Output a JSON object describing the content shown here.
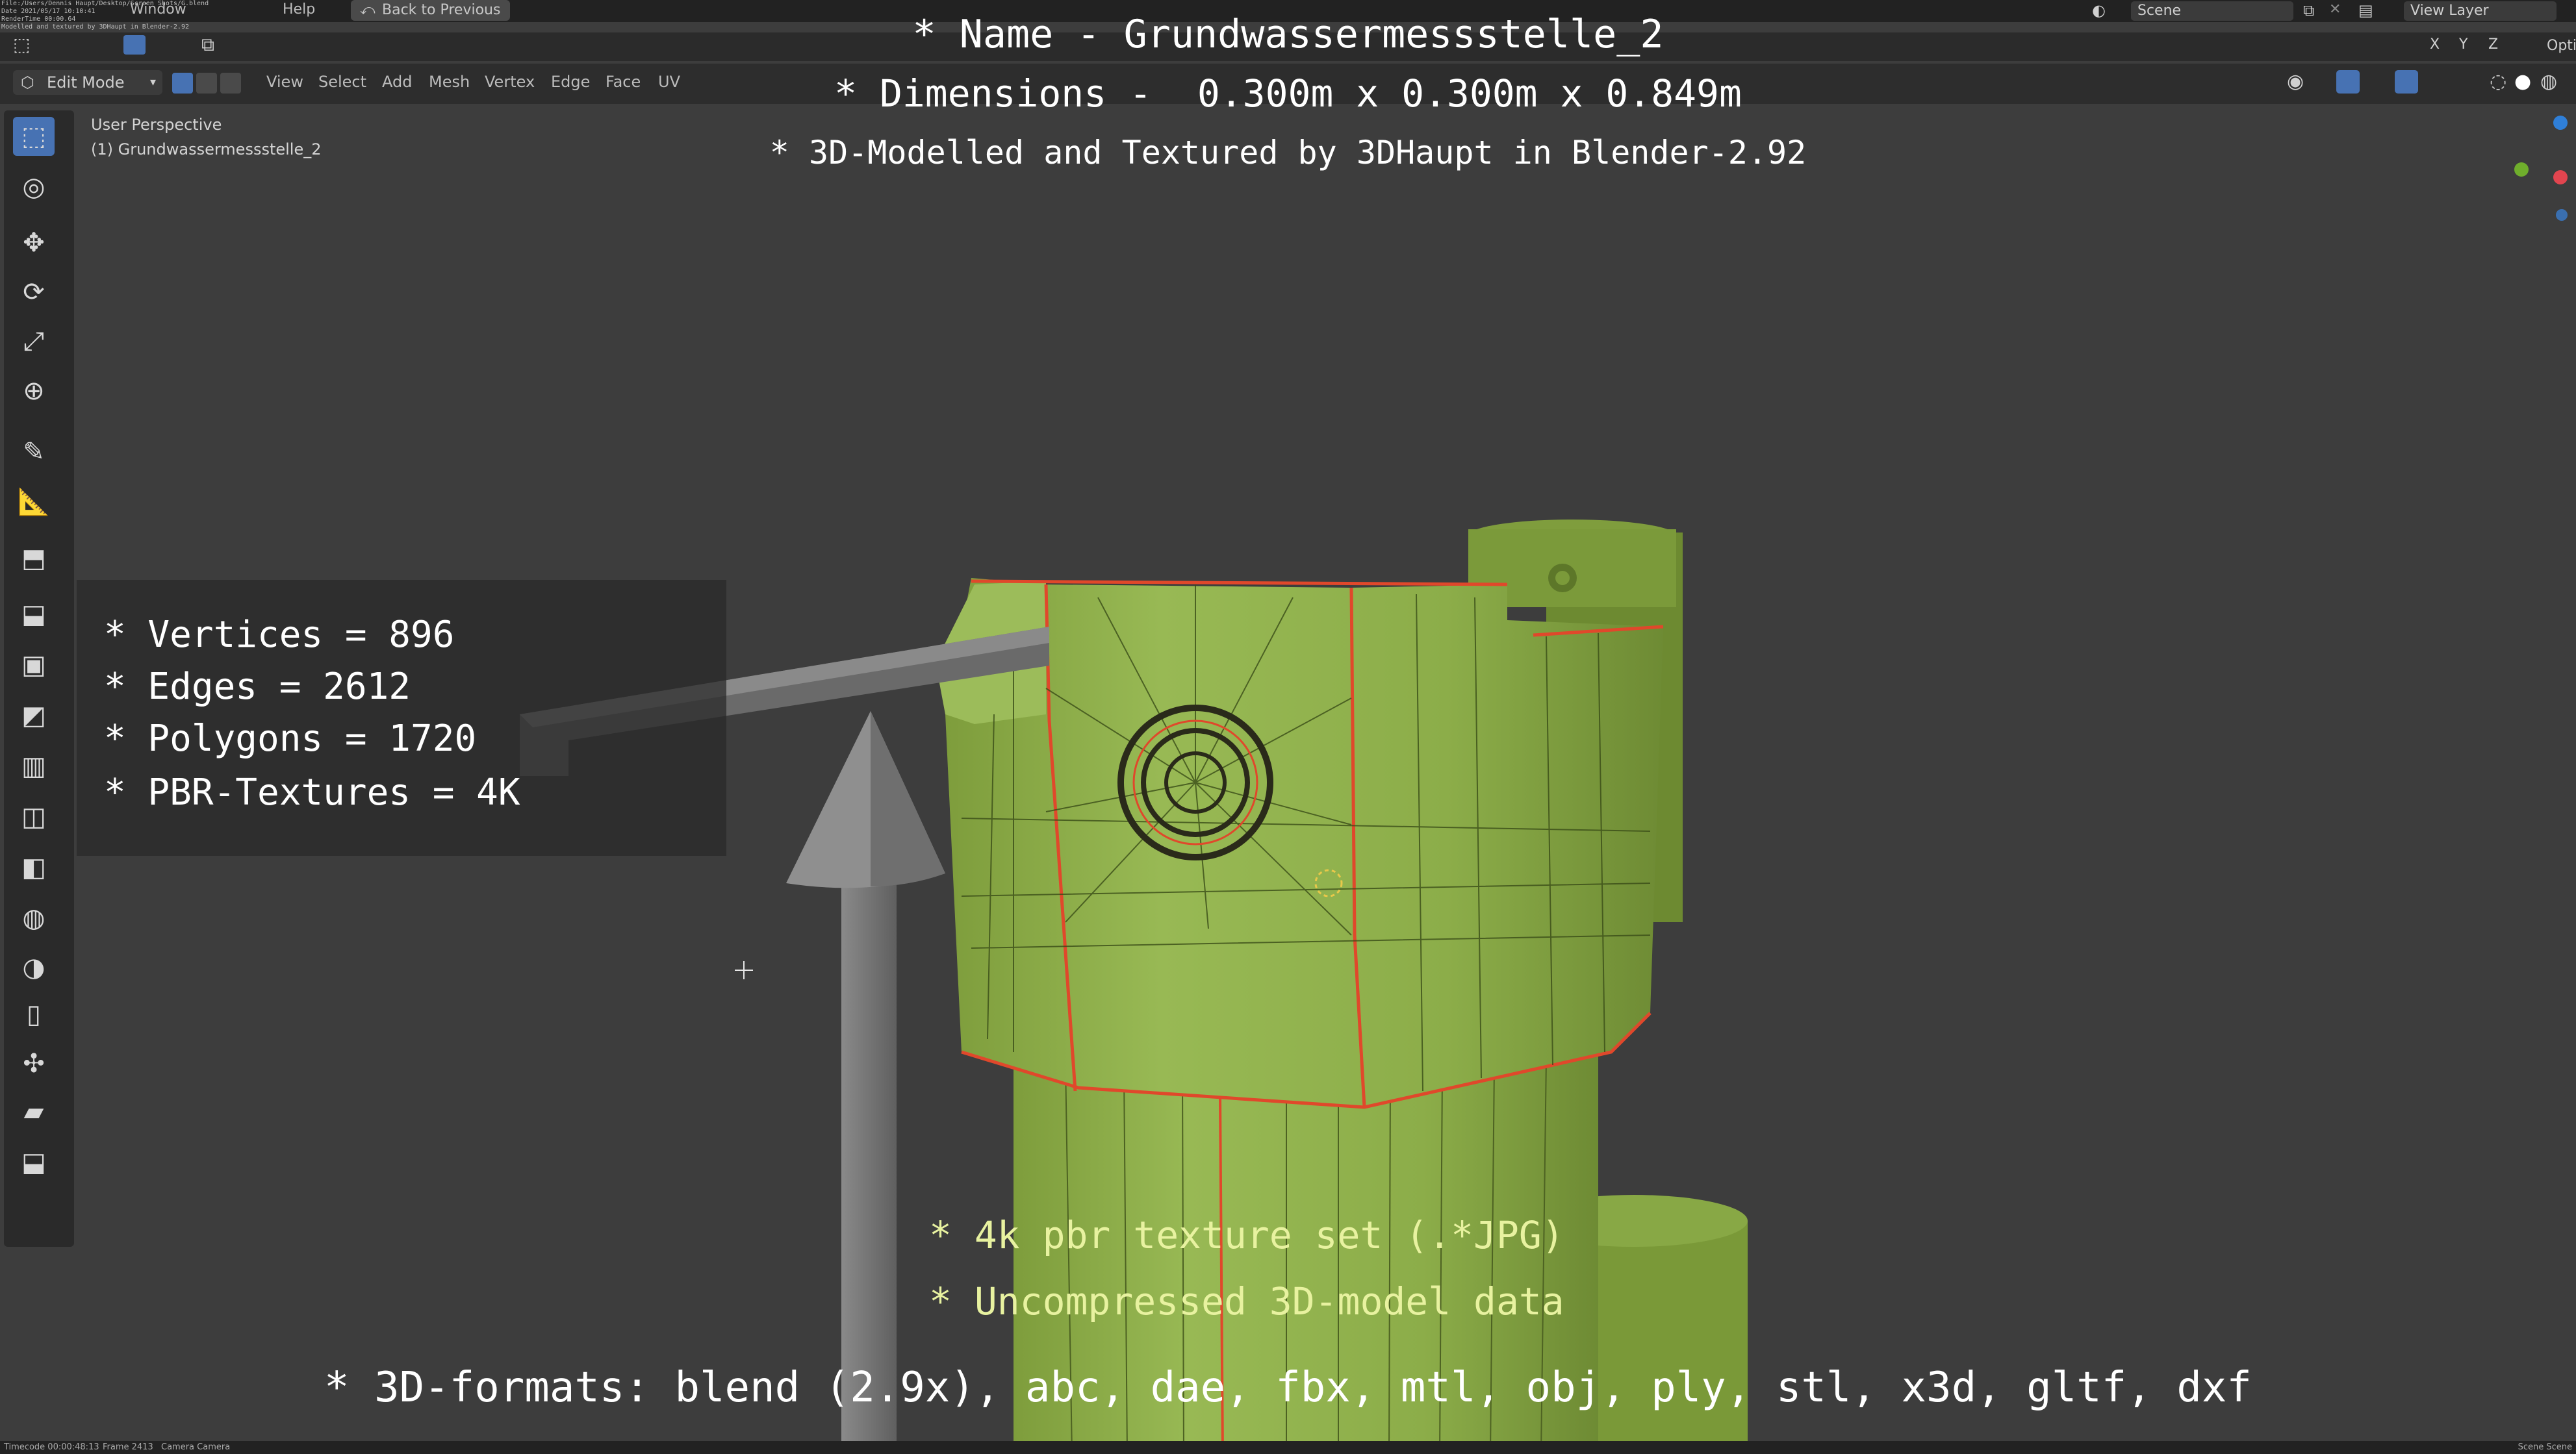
{
  "topbar": {
    "menu_window": "Window",
    "menu_help": "Help",
    "back_button": "Back to Previous",
    "scene_label": "Scene",
    "view_layer_label": "View Layer",
    "options_label": "Opti",
    "tiny_info": "File:/Users/Dennis Haupt/Desktop/Screen Shots/G.blend\nDate 2021/05/17 10:10:41\nRenderTime 00:00.64\nModelled and textured by 3DHaupt in Blender-2.92"
  },
  "header": {
    "mode": "Edit Mode",
    "menus": [
      "View",
      "Select",
      "Add",
      "Mesh",
      "Vertex",
      "Edge",
      "Face",
      "UV"
    ]
  },
  "viewport": {
    "perspective_label": "User Perspective",
    "object_label": "(1) Grundwassermessstelle_2"
  },
  "overlay": {
    "name_line": "* Name - Grundwassermessstelle_2",
    "dimensions_line": "* Dimensions -  0.300m x 0.300m x 0.849m",
    "credit_line": "* 3D-Modelled and Textured by 3DHaupt in Blender-2.92",
    "stats": [
      "* Vertices = 896",
      "* Edges = 2612",
      "* Polygons = 1720",
      "* PBR-Textures = 4K"
    ],
    "texture_line": "* 4k pbr texture set (.*JPG)",
    "uncompressed_line": "* Uncompressed 3D-model data",
    "formats_line": "* 3D-formats: blend (2.9x), abc, dae, fbx, mtl, obj, ply, stl, x3d, gltf, dxf"
  },
  "status_bar": {
    "timecode": "Timecode 00:00:48:13",
    "frame": "Frame 2413",
    "camera": "Camera Camera",
    "scene": "Scene Scene"
  },
  "colors": {
    "viewport_bg": "#3d3d3d",
    "model_green": "#8fb04a",
    "edge_red": "#e0482b",
    "active_tool": "#4772b3",
    "overlay_text": "#ffffff",
    "texture_text": "#e8f2a0"
  },
  "icons": {
    "tools": [
      "select-box-icon",
      "cursor-icon",
      "move-icon",
      "rotate-icon",
      "scale-icon",
      "transform-icon",
      "annotate-icon",
      "measure-icon",
      "add-cube-icon",
      "extrude-icon",
      "inset-icon",
      "bevel-icon",
      "loop-cut-icon",
      "knife-icon",
      "poly-build-icon",
      "spin-icon",
      "smooth-icon",
      "edge-slide-icon",
      "shrink-fatten-icon",
      "shear-icon",
      "rip-icon"
    ]
  }
}
